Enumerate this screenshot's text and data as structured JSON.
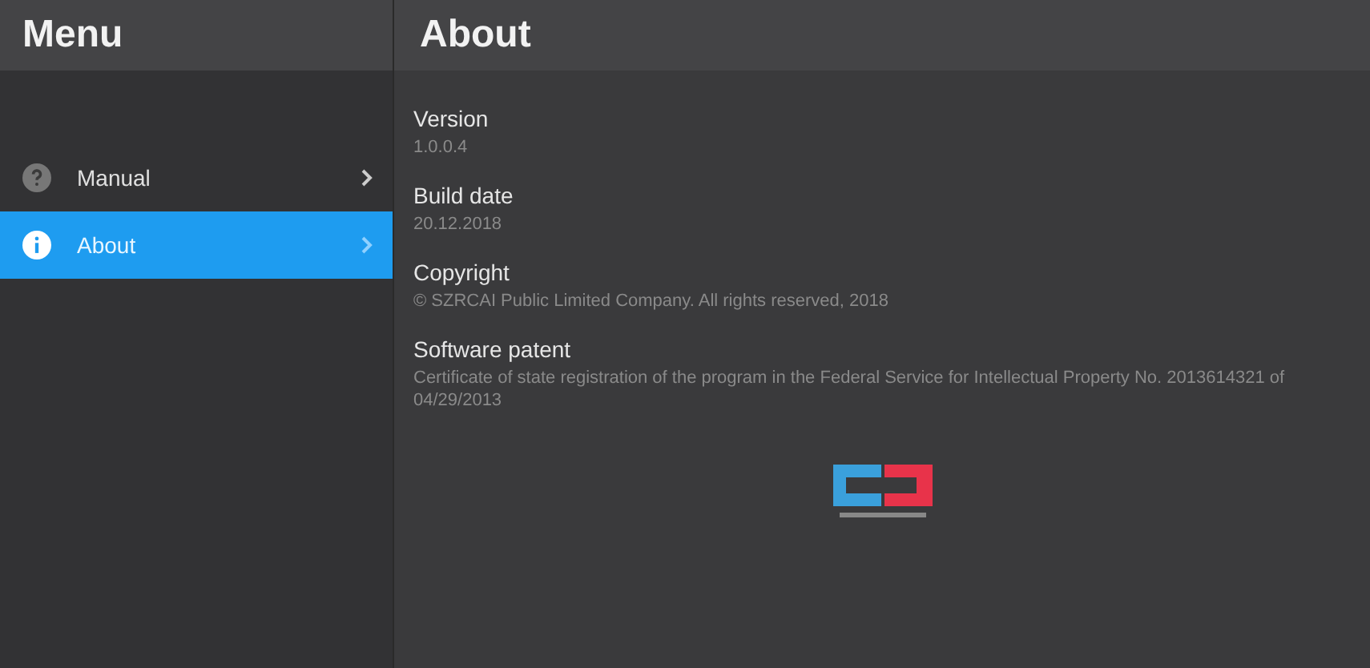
{
  "sidebar": {
    "title": "Menu",
    "items": [
      {
        "label": "Manual",
        "kind": "help",
        "selected": false
      },
      {
        "label": "About",
        "kind": "info",
        "selected": true
      }
    ]
  },
  "content": {
    "title": "About",
    "fields": [
      {
        "label": "Version",
        "value": "1.0.0.4"
      },
      {
        "label": "Build date",
        "value": "20.12.2018"
      },
      {
        "label": "Copyright",
        "value": "© SZRCAI Public Limited Company. All rights reserved, 2018"
      },
      {
        "label": "Software patent",
        "value": "Certificate of state registration of the program in the Federal Service for Intellectual Property No. 2013614321 of 04/29/2013"
      }
    ]
  }
}
